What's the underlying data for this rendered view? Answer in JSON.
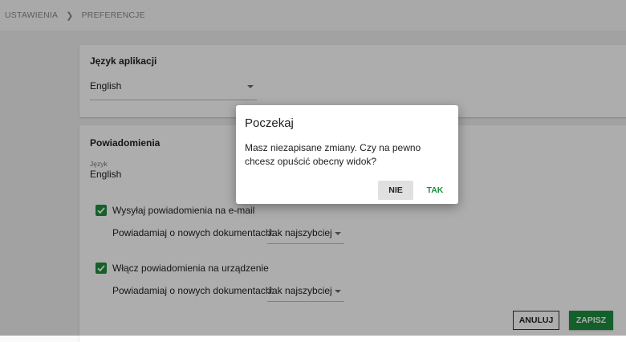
{
  "breadcrumb": {
    "items": [
      "USTAWIENIA",
      "PREFERENCJE"
    ]
  },
  "app_language": {
    "title": "Język aplikacji",
    "value": "English"
  },
  "notifications": {
    "title": "Powiadomienia",
    "language_label": "Język",
    "language_value": "English",
    "email": {
      "checked": true,
      "label": "Wysyłaj powiadomienia na e-mail",
      "frequency_label": "Powiadamiaj o nowych dokumentach:",
      "frequency_value": "Jak najszybciej"
    },
    "device": {
      "checked": true,
      "label": "Włącz powiadomienia na urządzenie",
      "frequency_label": "Powiadamiaj o nowych dokumentach:",
      "frequency_value": "Jak najszybciej"
    }
  },
  "actions": {
    "cancel": "ANULUJ",
    "save": "ZAPISZ"
  },
  "dialog": {
    "title": "Poczekaj",
    "message": "Masz niezapisane zmiany. Czy na pewno chcesz opuścić obecny widok?",
    "no": "NIE",
    "yes": "TAK"
  },
  "colors": {
    "accent": "#1e8e3e",
    "overlay": "rgba(0,0,0,0.32)"
  }
}
